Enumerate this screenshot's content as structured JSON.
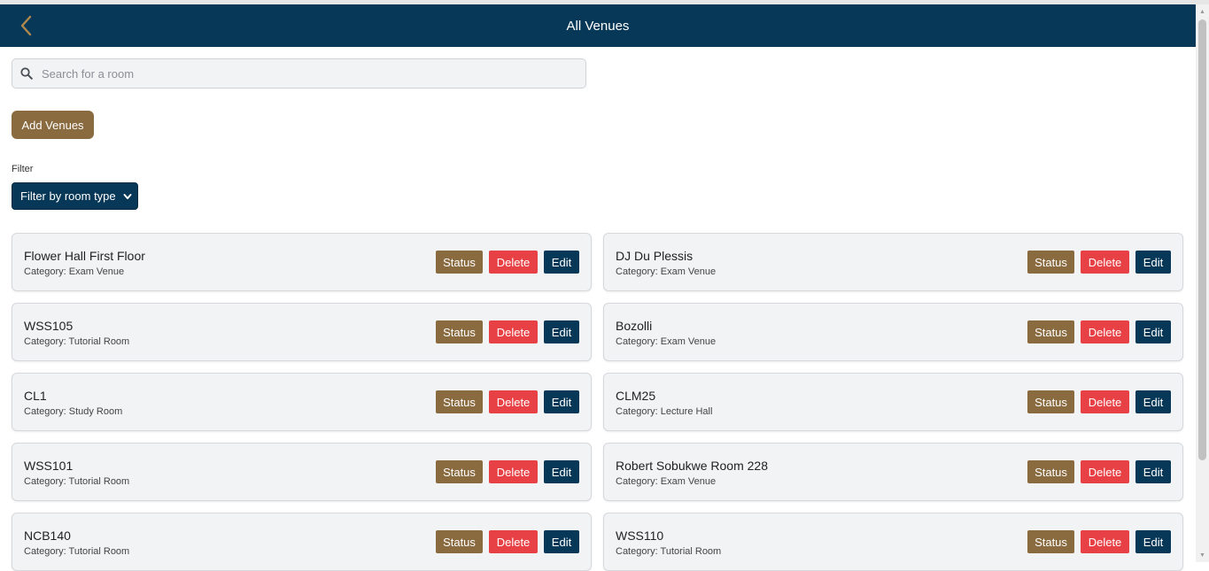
{
  "header": {
    "title": "All Venues",
    "back_icon": "chevron-left-icon"
  },
  "search": {
    "placeholder": "Search for a room",
    "value": ""
  },
  "actions": {
    "add_label": "Add Venues"
  },
  "filter": {
    "label": "Filter",
    "selected": "Filter by room type"
  },
  "buttons": {
    "status": "Status",
    "delete": "Delete",
    "edit": "Edit"
  },
  "colors": {
    "header_bg": "#073857",
    "accent_brown": "#8a6a3f",
    "delete_red": "#e84145",
    "back_arrow": "#b0894f"
  },
  "venues": [
    {
      "name": "Flower Hall First Floor",
      "category": "Category: Exam Venue"
    },
    {
      "name": "DJ Du Plessis",
      "category": "Category: Exam Venue"
    },
    {
      "name": "WSS105",
      "category": "Category: Tutorial Room"
    },
    {
      "name": "Bozolli",
      "category": "Category: Exam Venue"
    },
    {
      "name": "CL1",
      "category": "Category: Study Room"
    },
    {
      "name": "CLM25",
      "category": "Category: Lecture Hall"
    },
    {
      "name": "WSS101",
      "category": "Category: Tutorial Room"
    },
    {
      "name": "Robert Sobukwe Room 228",
      "category": "Category: Exam Venue"
    },
    {
      "name": "NCB140",
      "category": "Category: Tutorial Room"
    },
    {
      "name": "WSS110",
      "category": "Category: Tutorial Room"
    }
  ]
}
